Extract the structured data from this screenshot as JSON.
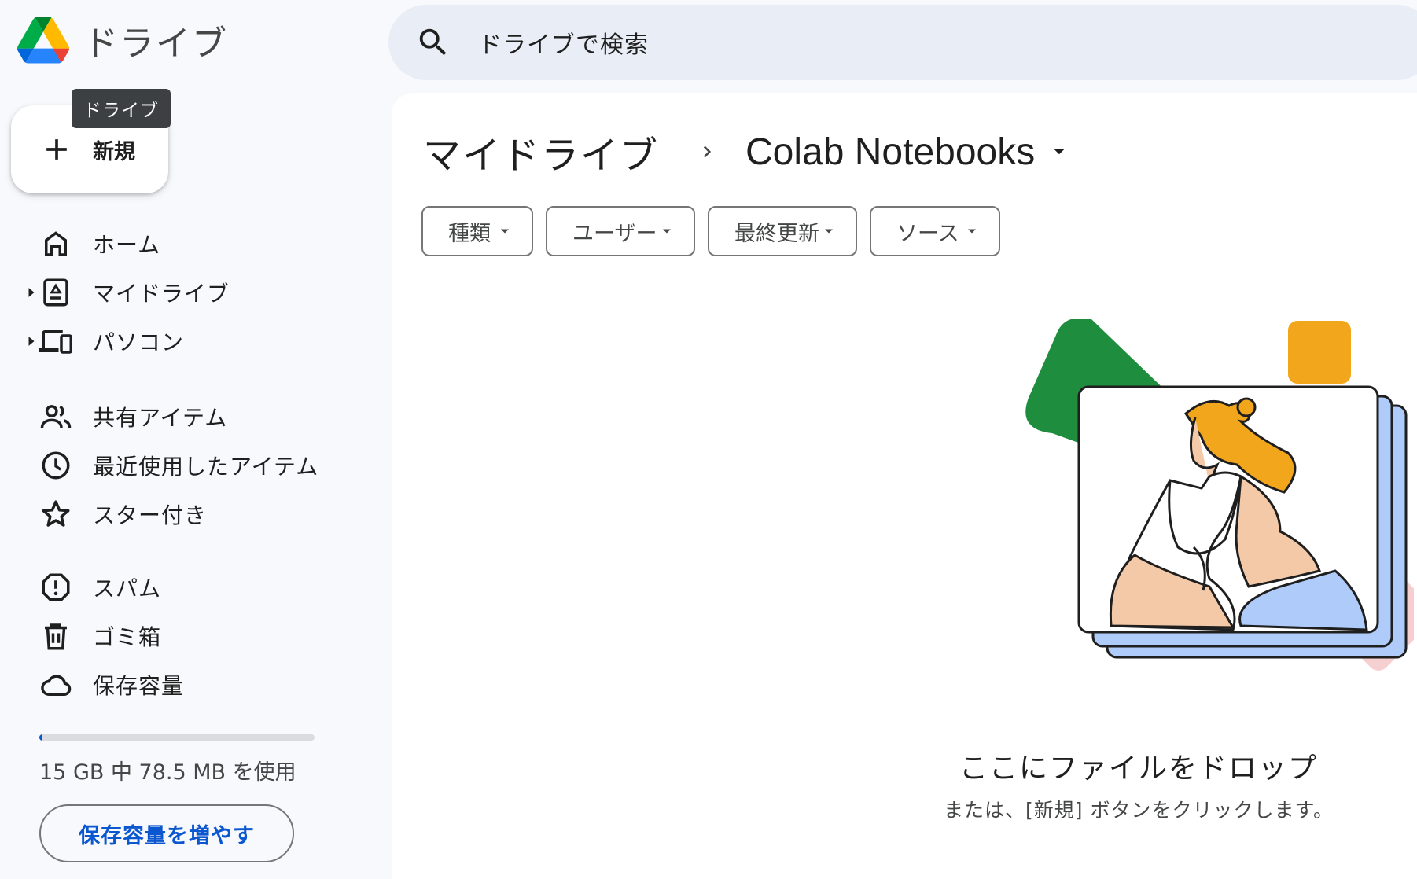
{
  "app": {
    "title": "ドライブ",
    "tooltip": "ドライブ"
  },
  "search": {
    "placeholder": "ドライブで検索"
  },
  "new_button": {
    "label": "新規"
  },
  "sidebar": {
    "items": [
      {
        "label": "ホーム",
        "icon": "home-icon"
      },
      {
        "label": "マイドライブ",
        "icon": "my-drive-icon"
      },
      {
        "label": "パソコン",
        "icon": "computers-icon"
      },
      {
        "label": "共有アイテム",
        "icon": "shared-icon"
      },
      {
        "label": "最近使用したアイテム",
        "icon": "clock-icon"
      },
      {
        "label": "スター付き",
        "icon": "star-icon"
      },
      {
        "label": "スパム",
        "icon": "spam-icon"
      },
      {
        "label": "ゴミ箱",
        "icon": "trash-icon"
      },
      {
        "label": "保存容量",
        "icon": "cloud-icon"
      }
    ]
  },
  "storage": {
    "used_text": "15 GB 中 78.5 MB を使用",
    "used_fraction": 0.005,
    "upgrade_label": "保存容量を増やす"
  },
  "breadcrumb": {
    "root": "マイドライブ",
    "current": "Colab Notebooks"
  },
  "filters": [
    {
      "label": "種類"
    },
    {
      "label": "ユーザー"
    },
    {
      "label": "最終更新"
    },
    {
      "label": "ソース"
    }
  ],
  "empty_state": {
    "title": "ここにファイルをドロップ",
    "subtitle": "または、[新規] ボタンをクリックします。"
  },
  "colors": {
    "accent": "#0b57d0",
    "sidebar_bg": "#f7f9fc",
    "search_bg": "#e9eef6"
  }
}
